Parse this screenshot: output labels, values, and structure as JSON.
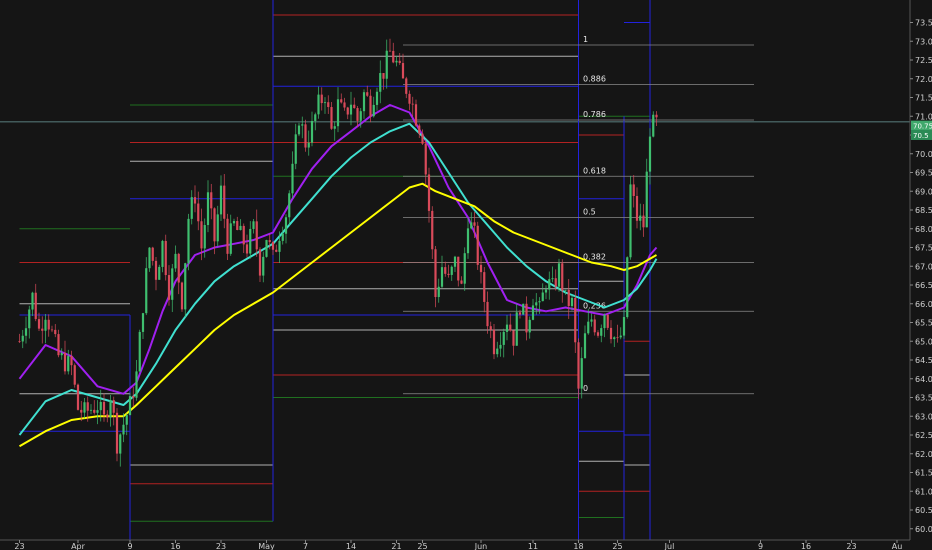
{
  "chart_data": {
    "type": "candlestick",
    "ylim": [
      59.7,
      74.1
    ],
    "x_tick_labels": [
      {
        "day": 0,
        "label": "23"
      },
      {
        "day": 9,
        "label": "Apr"
      },
      {
        "day": 17,
        "label": "9"
      },
      {
        "day": 24,
        "label": "16"
      },
      {
        "day": 31,
        "label": "23"
      },
      {
        "day": 38,
        "label": "May"
      },
      {
        "day": 44,
        "label": "7"
      },
      {
        "day": 51,
        "label": "14"
      },
      {
        "day": 58,
        "label": "21"
      },
      {
        "day": 62,
        "label": "25"
      },
      {
        "day": 71,
        "label": "Jun"
      },
      {
        "day": 79,
        "label": "11"
      },
      {
        "day": 86,
        "label": "18"
      },
      {
        "day": 92,
        "label": "25"
      },
      {
        "day": 100,
        "label": "Jul"
      },
      {
        "day": 114,
        "label": "9"
      },
      {
        "day": 121,
        "label": "16"
      },
      {
        "day": 128,
        "label": "23"
      },
      {
        "day": 135,
        "label": "Au"
      }
    ],
    "y_ticks": [
      60.0,
      60.5,
      61.0,
      61.5,
      62.0,
      62.5,
      63.0,
      63.5,
      64.0,
      64.5,
      65.0,
      65.5,
      66.0,
      66.5,
      67.0,
      67.5,
      68.0,
      68.5,
      69.0,
      69.5,
      70.0,
      70.5,
      71.0,
      71.5,
      72.0,
      72.5,
      73.0,
      73.5
    ],
    "last_price_labels": [
      {
        "value": 70.75,
        "text": "70.75",
        "color": "#3fa86b"
      },
      {
        "value": 70.5,
        "text": "70.5",
        "color": "#2b8a55"
      }
    ],
    "fib_levels": [
      {
        "label": "1",
        "value": 72.9
      },
      {
        "label": "0.886",
        "value": 71.85
      },
      {
        "label": "0.786",
        "value": 70.9
      },
      {
        "label": "0.618",
        "value": 69.4
      },
      {
        "label": "0.5",
        "value": 68.3
      },
      {
        "label": "0.382",
        "value": 67.1
      },
      {
        "label": "0.236",
        "value": 65.8
      },
      {
        "label": "0",
        "value": 63.6
      }
    ],
    "fib_start_day": 59,
    "fib_end_day": 113,
    "candle_anchors": [
      [
        0,
        65.0
      ],
      [
        2,
        66.2
      ],
      [
        3,
        65.3
      ],
      [
        4,
        65.8
      ],
      [
        6,
        64.6
      ],
      [
        8,
        64.3
      ],
      [
        9,
        63.2
      ],
      [
        10,
        63.1
      ],
      [
        12,
        63.3
      ],
      [
        13,
        62.9
      ],
      [
        14,
        63.6
      ],
      [
        15,
        62.3
      ],
      [
        17,
        63.3
      ],
      [
        18,
        64.1
      ],
      [
        19,
        66.0
      ],
      [
        20,
        67.5
      ],
      [
        21,
        66.8
      ],
      [
        22,
        67.6
      ],
      [
        23,
        66.4
      ],
      [
        24,
        67.2
      ],
      [
        25,
        66.1
      ],
      [
        26,
        68.3
      ],
      [
        27,
        68.9
      ],
      [
        28,
        67.5
      ],
      [
        29,
        68.8
      ],
      [
        30,
        67.7
      ],
      [
        31,
        69.0
      ],
      [
        32,
        67.6
      ],
      [
        33,
        68.1
      ],
      [
        34,
        67.8
      ],
      [
        35,
        67.5
      ],
      [
        36,
        68.0
      ],
      [
        37,
        67.0
      ],
      [
        38,
        67.8
      ],
      [
        39,
        67.2
      ],
      [
        40,
        67.9
      ],
      [
        41,
        68.4
      ],
      [
        42,
        69.5
      ],
      [
        43,
        71.0
      ],
      [
        44,
        70.3
      ],
      [
        45,
        70.7
      ],
      [
        46,
        71.3
      ],
      [
        47,
        71.6
      ],
      [
        48,
        70.6
      ],
      [
        49,
        71.3
      ],
      [
        50,
        71.0
      ],
      [
        51,
        71.4
      ],
      [
        52,
        70.9
      ],
      [
        53,
        71.6
      ],
      [
        54,
        71.3
      ],
      [
        55,
        71.9
      ],
      [
        56,
        72.2
      ],
      [
        57,
        72.7
      ],
      [
        58,
        72.4
      ],
      [
        59,
        71.9
      ],
      [
        60,
        71.6
      ],
      [
        61,
        71.0
      ],
      [
        62,
        70.5
      ],
      [
        63,
        68.5
      ],
      [
        64,
        66.2
      ],
      [
        65,
        67.0
      ],
      [
        66,
        66.6
      ],
      [
        67,
        67.1
      ],
      [
        68,
        66.4
      ],
      [
        69,
        68.3
      ],
      [
        70,
        67.8
      ],
      [
        71,
        66.6
      ],
      [
        72,
        65.6
      ],
      [
        73,
        64.9
      ],
      [
        74,
        65.2
      ],
      [
        75,
        65.6
      ],
      [
        76,
        65.1
      ],
      [
        77,
        66.0
      ],
      [
        78,
        65.4
      ],
      [
        79,
        66.2
      ],
      [
        80,
        65.8
      ],
      [
        81,
        66.6
      ],
      [
        82,
        66.4
      ],
      [
        83,
        66.9
      ],
      [
        84,
        66.1
      ],
      [
        85,
        66.0
      ],
      [
        86,
        63.7
      ],
      [
        87,
        65.1
      ],
      [
        88,
        65.6
      ],
      [
        89,
        65.3
      ],
      [
        90,
        65.8
      ],
      [
        91,
        65.3
      ],
      [
        92,
        64.9
      ],
      [
        93,
        65.4
      ],
      [
        94,
        69.1
      ],
      [
        95,
        68.3
      ],
      [
        96,
        68.1
      ],
      [
        97,
        70.7
      ],
      [
        98,
        70.8
      ]
    ],
    "moving_averages": [
      {
        "color": "#a020f0",
        "points": [
          [
            0,
            64.0
          ],
          [
            4,
            64.9
          ],
          [
            8,
            64.6
          ],
          [
            12,
            63.8
          ],
          [
            16,
            63.6
          ],
          [
            18,
            63.9
          ],
          [
            20,
            64.8
          ],
          [
            22,
            65.8
          ],
          [
            24,
            66.6
          ],
          [
            27,
            67.3
          ],
          [
            30,
            67.5
          ],
          [
            33,
            67.6
          ],
          [
            36,
            67.7
          ],
          [
            39,
            67.9
          ],
          [
            42,
            68.8
          ],
          [
            45,
            69.6
          ],
          [
            48,
            70.2
          ],
          [
            51,
            70.6
          ],
          [
            54,
            71.0
          ],
          [
            57,
            71.3
          ],
          [
            60,
            71.1
          ],
          [
            63,
            70.2
          ],
          [
            66,
            69.1
          ],
          [
            69,
            68.3
          ],
          [
            72,
            67.1
          ],
          [
            75,
            66.1
          ],
          [
            78,
            65.9
          ],
          [
            81,
            65.8
          ],
          [
            84,
            65.9
          ],
          [
            87,
            65.8
          ],
          [
            90,
            65.7
          ],
          [
            93,
            65.9
          ],
          [
            95,
            66.5
          ],
          [
            97,
            67.3
          ],
          [
            98,
            67.5
          ]
        ]
      },
      {
        "color": "#40e0d0",
        "points": [
          [
            0,
            62.5
          ],
          [
            4,
            63.4
          ],
          [
            8,
            63.7
          ],
          [
            12,
            63.5
          ],
          [
            16,
            63.3
          ],
          [
            18,
            63.6
          ],
          [
            21,
            64.4
          ],
          [
            24,
            65.3
          ],
          [
            27,
            66.0
          ],
          [
            30,
            66.6
          ],
          [
            33,
            67.0
          ],
          [
            36,
            67.3
          ],
          [
            39,
            67.6
          ],
          [
            42,
            68.2
          ],
          [
            45,
            68.8
          ],
          [
            48,
            69.4
          ],
          [
            51,
            69.9
          ],
          [
            54,
            70.3
          ],
          [
            57,
            70.6
          ],
          [
            60,
            70.8
          ],
          [
            63,
            70.3
          ],
          [
            66,
            69.5
          ],
          [
            69,
            68.7
          ],
          [
            72,
            68.1
          ],
          [
            75,
            67.5
          ],
          [
            78,
            67.0
          ],
          [
            81,
            66.6
          ],
          [
            84,
            66.3
          ],
          [
            87,
            66.1
          ],
          [
            90,
            65.9
          ],
          [
            93,
            66.1
          ],
          [
            95,
            66.4
          ],
          [
            97,
            66.9
          ],
          [
            98,
            67.2
          ]
        ]
      },
      {
        "color": "#ffff00",
        "points": [
          [
            0,
            62.2
          ],
          [
            4,
            62.6
          ],
          [
            8,
            62.9
          ],
          [
            12,
            63.0
          ],
          [
            16,
            63.0
          ],
          [
            18,
            63.3
          ],
          [
            21,
            63.8
          ],
          [
            24,
            64.3
          ],
          [
            27,
            64.8
          ],
          [
            30,
            65.3
          ],
          [
            33,
            65.7
          ],
          [
            36,
            66.0
          ],
          [
            39,
            66.3
          ],
          [
            42,
            66.7
          ],
          [
            45,
            67.1
          ],
          [
            48,
            67.5
          ],
          [
            51,
            67.9
          ],
          [
            54,
            68.3
          ],
          [
            57,
            68.7
          ],
          [
            60,
            69.1
          ],
          [
            62,
            69.2
          ],
          [
            64,
            69.0
          ],
          [
            67,
            68.8
          ],
          [
            70,
            68.6
          ],
          [
            73,
            68.2
          ],
          [
            76,
            67.9
          ],
          [
            79,
            67.7
          ],
          [
            82,
            67.5
          ],
          [
            85,
            67.3
          ],
          [
            88,
            67.1
          ],
          [
            91,
            67.0
          ],
          [
            93,
            66.9
          ],
          [
            95,
            67.0
          ],
          [
            97,
            67.2
          ],
          [
            98,
            67.3
          ]
        ]
      }
    ],
    "horizontal_levels": [
      {
        "start": 0,
        "end": 17,
        "value": 67.1,
        "color": "#b22222"
      },
      {
        "start": 0,
        "end": 17,
        "value": 66.0,
        "color": "#b0b0b0"
      },
      {
        "start": 0,
        "end": 17,
        "value": 65.7,
        "color": "#2222dd"
      },
      {
        "start": 0,
        "end": 17,
        "value": 63.6,
        "color": "#b0b0b0"
      },
      {
        "start": 0,
        "end": 17,
        "value": 62.6,
        "color": "#2222dd"
      },
      {
        "start": 0,
        "end": 17,
        "value": 68.0,
        "color": "#207020"
      },
      {
        "start": 17,
        "end": 39,
        "value": 71.3,
        "color": "#207020"
      },
      {
        "start": 17,
        "end": 39,
        "value": 70.3,
        "color": "#b22222"
      },
      {
        "start": 17,
        "end": 39,
        "value": 69.8,
        "color": "#b0b0b0"
      },
      {
        "start": 17,
        "end": 39,
        "value": 68.8,
        "color": "#2222dd"
      },
      {
        "start": 17,
        "end": 39,
        "value": 61.2,
        "color": "#b22222"
      },
      {
        "start": 17,
        "end": 39,
        "value": 61.7,
        "color": "#b0b0b0"
      },
      {
        "start": 17,
        "end": 39,
        "value": 60.2,
        "color": "#207020"
      },
      {
        "start": 39,
        "end": 86,
        "value": 73.7,
        "color": "#b22222"
      },
      {
        "start": 39,
        "end": 86,
        "value": 72.6,
        "color": "#b0b0b0"
      },
      {
        "start": 39,
        "end": 86,
        "value": 71.8,
        "color": "#2222dd"
      },
      {
        "start": 39,
        "end": 86,
        "value": 70.3,
        "color": "#b22222"
      },
      {
        "start": 39,
        "end": 86,
        "value": 69.4,
        "color": "#207020"
      },
      {
        "start": 39,
        "end": 86,
        "value": 67.1,
        "color": "#b22222"
      },
      {
        "start": 39,
        "end": 86,
        "value": 66.4,
        "color": "#b0b0b0"
      },
      {
        "start": 39,
        "end": 86,
        "value": 65.7,
        "color": "#2222dd"
      },
      {
        "start": 39,
        "end": 86,
        "value": 65.3,
        "color": "#b0b0b0"
      },
      {
        "start": 39,
        "end": 86,
        "value": 64.1,
        "color": "#b22222"
      },
      {
        "start": 39,
        "end": 86,
        "value": 63.5,
        "color": "#207020"
      },
      {
        "start": 86,
        "end": 93,
        "value": 71.0,
        "color": "#207020"
      },
      {
        "start": 86,
        "end": 93,
        "value": 70.5,
        "color": "#b22222"
      },
      {
        "start": 86,
        "end": 93,
        "value": 68.8,
        "color": "#2222dd"
      },
      {
        "start": 86,
        "end": 93,
        "value": 66.6,
        "color": "#b0b0b0"
      },
      {
        "start": 86,
        "end": 93,
        "value": 62.6,
        "color": "#2222dd"
      },
      {
        "start": 86,
        "end": 93,
        "value": 61.8,
        "color": "#b0b0b0"
      },
      {
        "start": 86,
        "end": 93,
        "value": 61.0,
        "color": "#b22222"
      },
      {
        "start": 86,
        "end": 93,
        "value": 60.3,
        "color": "#207020"
      },
      {
        "start": 93,
        "end": 97,
        "value": 73.5,
        "color": "#2222dd"
      },
      {
        "start": 93,
        "end": 97,
        "value": 71.0,
        "color": "#207020"
      },
      {
        "start": 93,
        "end": 97,
        "value": 65.0,
        "color": "#b22222"
      },
      {
        "start": 93,
        "end": 97,
        "value": 64.1,
        "color": "#b0b0b0"
      },
      {
        "start": 93,
        "end": 97,
        "value": 62.5,
        "color": "#2222dd"
      },
      {
        "start": 93,
        "end": 97,
        "value": 61.7,
        "color": "#b0b0b0"
      },
      {
        "start": 93,
        "end": 97,
        "value": 61.0,
        "color": "#b22222"
      }
    ],
    "vertical_levels": [
      {
        "day": 17,
        "from": 65.7,
        "to": 59.7,
        "color": "#2222dd"
      },
      {
        "day": 39,
        "from": 74.1,
        "to": 60.2,
        "color": "#2222dd"
      },
      {
        "day": 86,
        "from": 74.1,
        "to": 59.7,
        "color": "#2222dd"
      },
      {
        "day": 93,
        "from": 71.0,
        "to": 59.7,
        "color": "#2222dd"
      },
      {
        "day": 97,
        "from": 74.1,
        "to": 59.7,
        "color": "#2222dd"
      }
    ],
    "cross_line": {
      "value": 70.85,
      "color": "#6fa0a0"
    }
  }
}
